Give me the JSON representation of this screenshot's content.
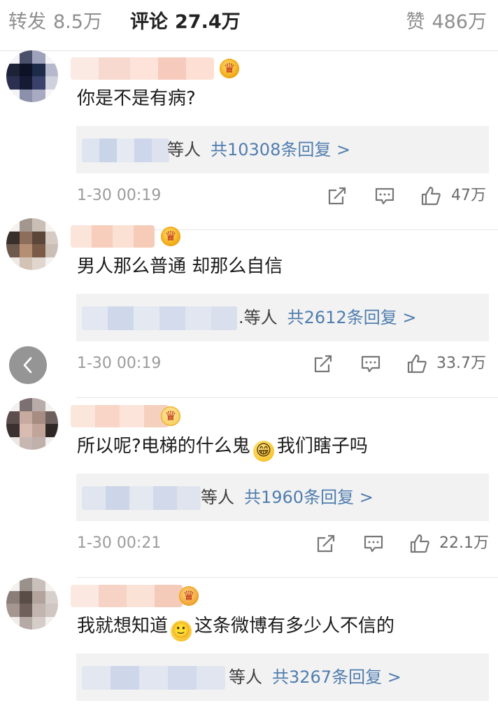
{
  "tabs": {
    "forward_label": "转发",
    "forward_count": "8.5万",
    "comment_label": "评论",
    "comment_count": "27.4万",
    "like_label": "赞",
    "like_count": "486万"
  },
  "icons": {
    "share": "share-icon",
    "comment": "comment-icon",
    "like": "thumbs-up-icon",
    "back": "chevron-left-icon",
    "badge": "crown-badge-icon"
  },
  "colors": {
    "link": "#507daf",
    "muted": "#9b9b9b",
    "reply_bg": "#f2f2f2"
  },
  "comments": [
    {
      "text": "你是不是有病?",
      "reply_who": "等人",
      "reply_total": "共10308条回复 >",
      "time": "1-30 00:19",
      "likes": "47万"
    },
    {
      "text": "男人那么普通 却那么自信",
      "reply_who": ".等人",
      "reply_total": "共2612条回复 >",
      "time": "1-30 00:19",
      "likes": "33.7万"
    },
    {
      "text_before": "所以呢?电梯的什么鬼",
      "text_after": "我们瞎子吗",
      "emoji": "😁",
      "reply_who": "等人",
      "reply_total": "共1960条回复 >",
      "time": "1-30 00:21",
      "likes": "22.1万"
    },
    {
      "text_before": "我就想知道",
      "text_after": "这条微博有多少人不信的",
      "emoji": "🙂",
      "reply_who": "等人",
      "reply_total": "共3267条回复 >"
    }
  ]
}
